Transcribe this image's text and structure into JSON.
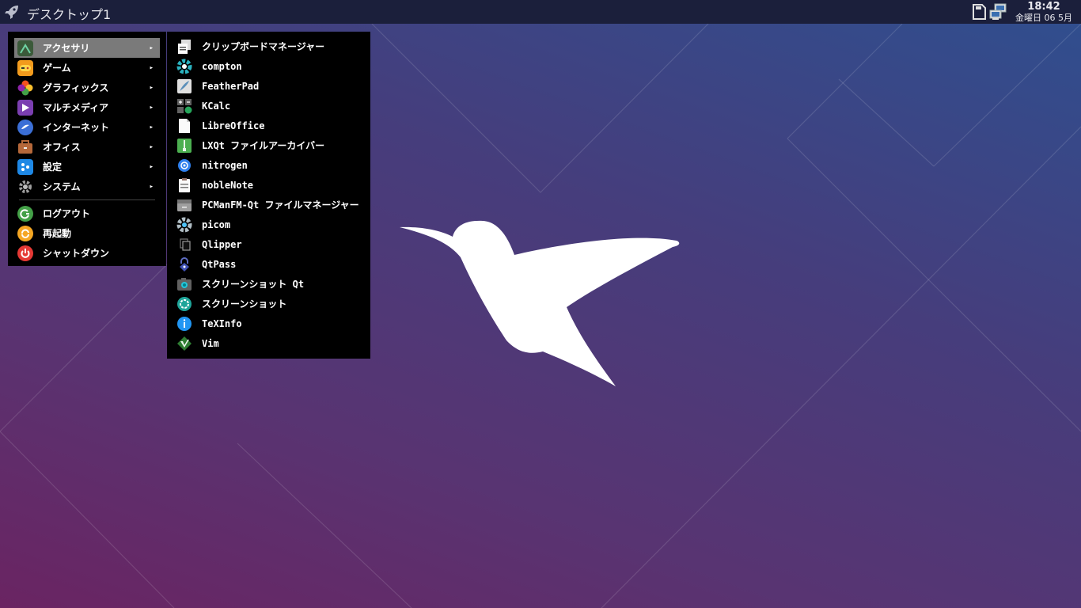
{
  "panel": {
    "desktop_name": "デスクトップ1",
    "clock_time": "18:42",
    "clock_date": "金曜日 06 5月"
  },
  "main_menu": {
    "items": [
      {
        "label": "アクセサリ",
        "icon": "accessories-icon",
        "arrow": "▸"
      },
      {
        "label": "ゲーム",
        "icon": "games-icon",
        "arrow": "▸"
      },
      {
        "label": "グラフィックス",
        "icon": "graphics-icon",
        "arrow": "▸"
      },
      {
        "label": "マルチメディア",
        "icon": "multimedia-icon",
        "arrow": "▸"
      },
      {
        "label": "インターネット",
        "icon": "internet-icon",
        "arrow": "▸"
      },
      {
        "label": "オフィス",
        "icon": "office-icon",
        "arrow": "▸"
      },
      {
        "label": "設定",
        "icon": "settings-icon",
        "arrow": "▸"
      },
      {
        "label": "システム",
        "icon": "system-icon",
        "arrow": "▸"
      }
    ],
    "session": [
      {
        "label": "ログアウト",
        "icon": "logout-icon"
      },
      {
        "label": "再起動",
        "icon": "reboot-icon"
      },
      {
        "label": "シャットダウン",
        "icon": "shutdown-icon"
      }
    ]
  },
  "submenu": {
    "items": [
      {
        "label": "クリップボードマネージャー",
        "icon": "clipboard-manager-icon"
      },
      {
        "label": "compton",
        "icon": "compton-icon"
      },
      {
        "label": "FeatherPad",
        "icon": "featherpad-icon"
      },
      {
        "label": "KCalc",
        "icon": "kcalc-icon"
      },
      {
        "label": "LibreOffice",
        "icon": "libreoffice-icon"
      },
      {
        "label": "LXQt ファイルアーカイバー",
        "icon": "archiver-icon"
      },
      {
        "label": "nitrogen",
        "icon": "nitrogen-icon"
      },
      {
        "label": "nobleNote",
        "icon": "noblenote-icon"
      },
      {
        "label": "PCManFM-Qt ファイルマネージャー",
        "icon": "file-manager-icon"
      },
      {
        "label": "picom",
        "icon": "picom-icon"
      },
      {
        "label": "Qlipper",
        "icon": "qlipper-icon"
      },
      {
        "label": "QtPass",
        "icon": "qtpass-icon"
      },
      {
        "label": "スクリーンショット Qt",
        "icon": "screenshot-qt-icon"
      },
      {
        "label": "スクリーンショット",
        "icon": "screenshot-icon"
      },
      {
        "label": "TeXInfo",
        "icon": "texinfo-icon"
      },
      {
        "label": "Vim",
        "icon": "vim-icon"
      }
    ]
  },
  "colors": {
    "panel_bg": "#1b1f3b",
    "menu_bg": "#000000",
    "menu_active": "#7a7a7a",
    "wallpaper_top": "#2f4f8f",
    "wallpaper_bottom": "#6a2462"
  }
}
